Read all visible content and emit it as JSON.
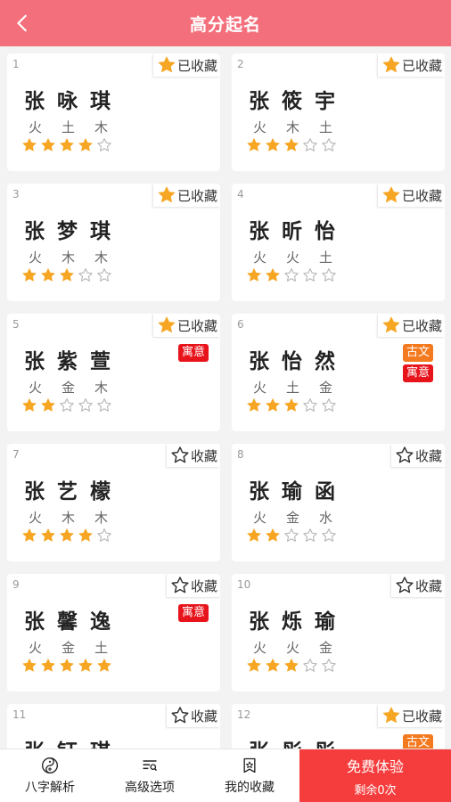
{
  "header": {
    "title": "高分起名",
    "back_icon": "chevron-left-icon",
    "background": "#f46f7c"
  },
  "labels": {
    "favorited": "已收藏",
    "favorite": "收藏"
  },
  "colors": {
    "star_filled": "#f6a623",
    "star_empty": "#b8b8b8",
    "tag_meaning": "#e8141b",
    "tag_classic": "#f47a1f",
    "cta": "#f63d3d"
  },
  "cards": [
    {
      "index": "1",
      "chars": [
        "张",
        "咏",
        "琪"
      ],
      "elements": [
        "火",
        "土",
        "木"
      ],
      "rating": 4,
      "favorited": true,
      "tags": []
    },
    {
      "index": "2",
      "chars": [
        "张",
        "筱",
        "宇"
      ],
      "elements": [
        "火",
        "木",
        "土"
      ],
      "rating": 3,
      "favorited": true,
      "tags": []
    },
    {
      "index": "3",
      "chars": [
        "张",
        "梦",
        "琪"
      ],
      "elements": [
        "火",
        "木",
        "木"
      ],
      "rating": 3,
      "favorited": true,
      "tags": []
    },
    {
      "index": "4",
      "chars": [
        "张",
        "昕",
        "怡"
      ],
      "elements": [
        "火",
        "火",
        "土"
      ],
      "rating": 2,
      "favorited": true,
      "tags": []
    },
    {
      "index": "5",
      "chars": [
        "张",
        "紫",
        "萱"
      ],
      "elements": [
        "火",
        "金",
        "木"
      ],
      "rating": 2,
      "favorited": true,
      "tags": [
        {
          "text": "寓意",
          "kind": "red"
        }
      ]
    },
    {
      "index": "6",
      "chars": [
        "张",
        "怡",
        "然"
      ],
      "elements": [
        "火",
        "土",
        "金"
      ],
      "rating": 3,
      "favorited": true,
      "tags": [
        {
          "text": "古文",
          "kind": "orange"
        },
        {
          "text": "寓意",
          "kind": "red"
        }
      ]
    },
    {
      "index": "7",
      "chars": [
        "张",
        "艺",
        "檬"
      ],
      "elements": [
        "火",
        "木",
        "木"
      ],
      "rating": 4,
      "favorited": false,
      "tags": []
    },
    {
      "index": "8",
      "chars": [
        "张",
        "瑜",
        "函"
      ],
      "elements": [
        "火",
        "金",
        "水"
      ],
      "rating": 2,
      "favorited": false,
      "tags": []
    },
    {
      "index": "9",
      "chars": [
        "张",
        "馨",
        "逸"
      ],
      "elements": [
        "火",
        "金",
        "土"
      ],
      "rating": 5,
      "favorited": false,
      "tags": [
        {
          "text": "寓意",
          "kind": "red"
        }
      ]
    },
    {
      "index": "10",
      "chars": [
        "张",
        "烁",
        "瑜"
      ],
      "elements": [
        "火",
        "火",
        "金"
      ],
      "rating": 3,
      "favorited": false,
      "tags": []
    },
    {
      "index": "11",
      "chars": [
        "张",
        "钰",
        "琪"
      ],
      "elements": [
        "",
        "",
        ""
      ],
      "rating": 0,
      "favorited": false,
      "tags": []
    },
    {
      "index": "12",
      "chars": [
        "张",
        "彤",
        "彤"
      ],
      "elements": [
        "",
        "",
        ""
      ],
      "rating": 0,
      "favorited": true,
      "tags": [
        {
          "text": "古文",
          "kind": "orange"
        }
      ]
    }
  ],
  "bottom_nav": {
    "items": [
      {
        "label": "八字解析",
        "icon": "yin-yang-icon"
      },
      {
        "label": "高级选项",
        "icon": "filter-search-icon"
      },
      {
        "label": "我的收藏",
        "icon": "favorites-icon"
      }
    ],
    "cta": {
      "title": "免费体验",
      "subtitle": "剩余0次"
    }
  }
}
